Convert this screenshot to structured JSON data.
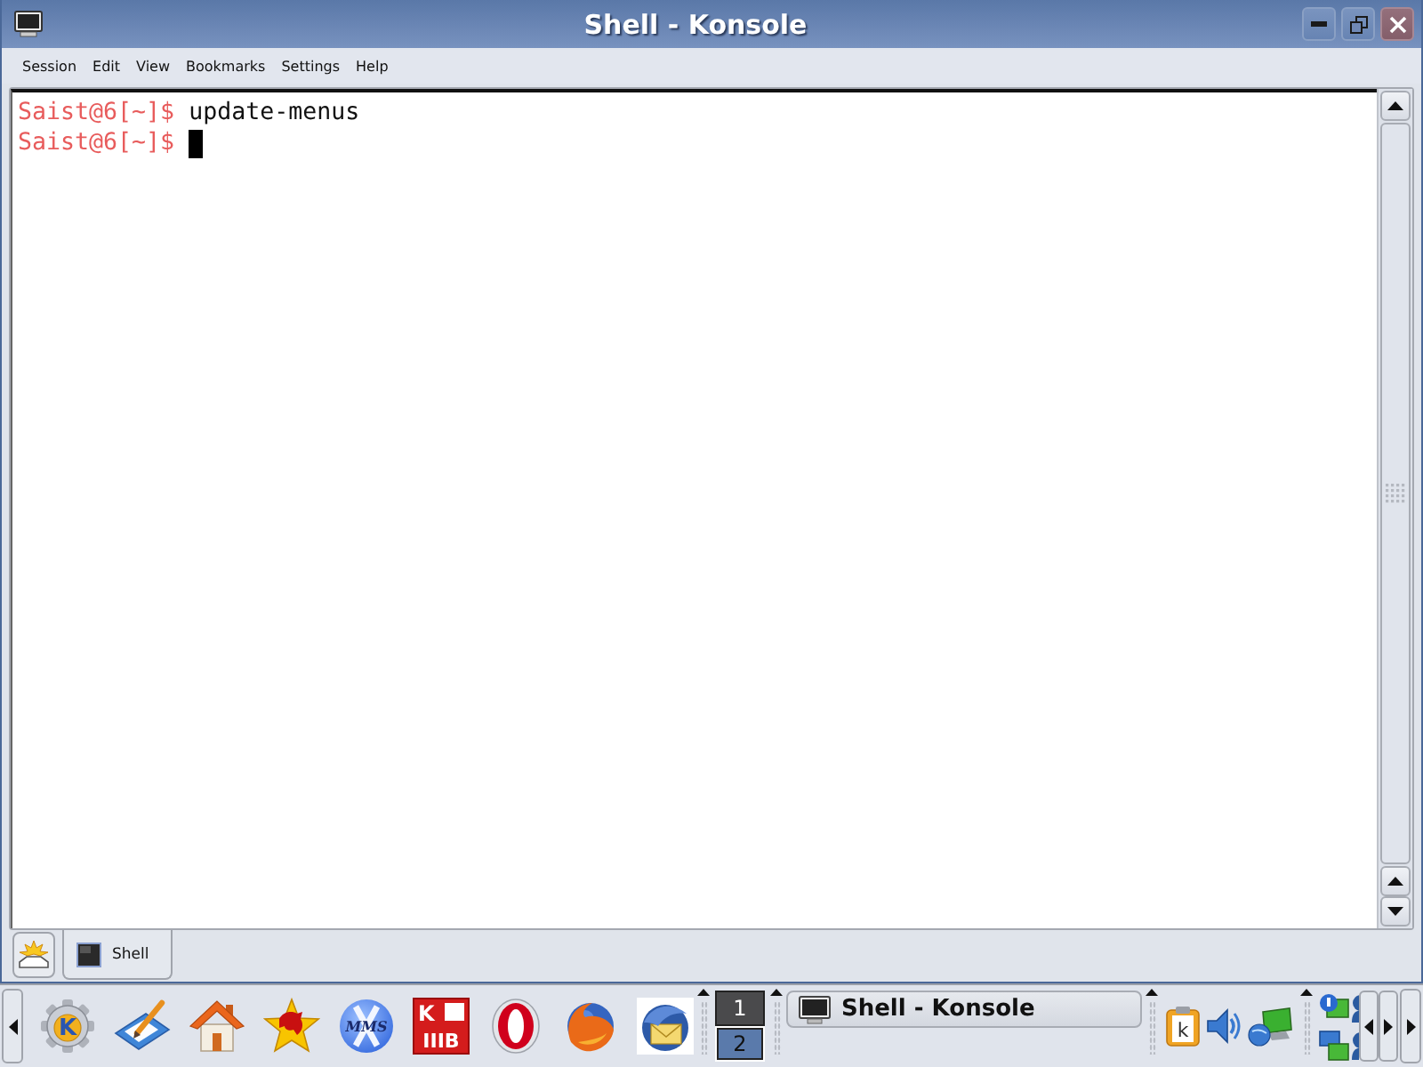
{
  "window": {
    "title": "Shell - Konsole"
  },
  "menu": [
    "Session",
    "Edit",
    "View",
    "Bookmarks",
    "Settings",
    "Help"
  ],
  "terminal": {
    "lines": [
      {
        "prompt": "Saist@6[~]$",
        "command": "update-menus",
        "cursor": false
      },
      {
        "prompt": "Saist@6[~]$",
        "cursor": true
      }
    ]
  },
  "tabs": [
    {
      "label": "Shell",
      "selected": true
    }
  ],
  "taskbar": {
    "quick_launch": [
      {
        "kind": "gear",
        "marks": [
          "K"
        ]
      },
      {
        "kind": "pencil"
      },
      {
        "kind": "home"
      },
      {
        "kind": "star"
      },
      {
        "kind": "x-circle",
        "marks": [
          "MMS"
        ]
      },
      {
        "kind": "letter-tile",
        "marks": [
          "K",
          "IIIB"
        ]
      },
      {
        "kind": "ring"
      },
      {
        "kind": "fox-globe"
      },
      {
        "kind": "bird-globe"
      }
    ],
    "pager": [
      {
        "label": "1",
        "selected": false
      },
      {
        "label": "2",
        "selected": true
      }
    ],
    "tasks": [
      {
        "label": "Shell - Konsole"
      }
    ],
    "tray": [
      {
        "kind": "clipboard",
        "marks": [
          "k"
        ]
      },
      {
        "kind": "speaker"
      },
      {
        "kind": "network"
      }
    ]
  }
}
